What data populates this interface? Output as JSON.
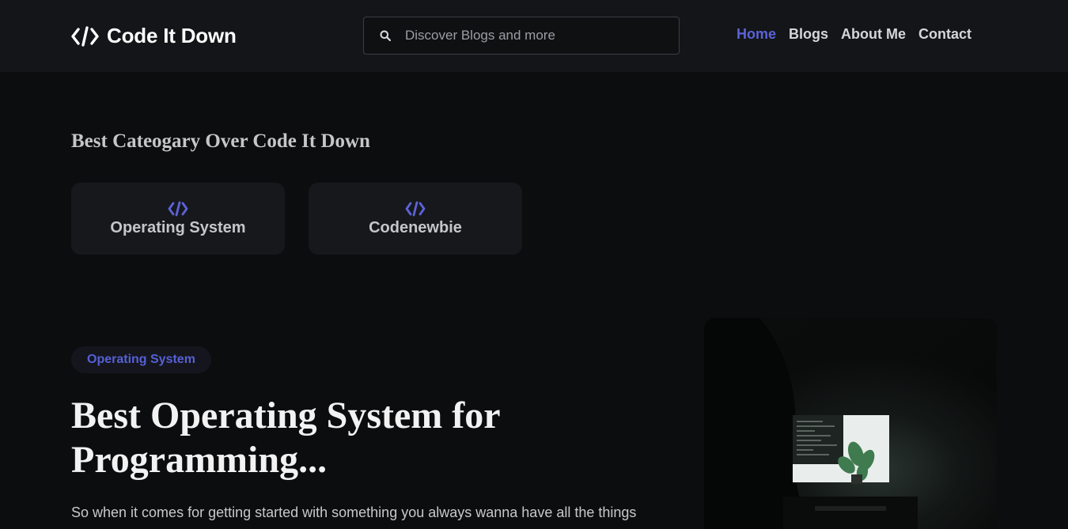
{
  "header": {
    "logo_icon": "code-icon",
    "logo_text": "Code It Down",
    "search": {
      "icon": "search-icon",
      "placeholder": "Discover Blogs and more",
      "value": ""
    },
    "nav": [
      {
        "label": "Home",
        "active": true
      },
      {
        "label": "Blogs",
        "active": false
      },
      {
        "label": "About Me",
        "active": false
      },
      {
        "label": "Contact",
        "active": false
      }
    ]
  },
  "categories": {
    "title": "Best Cateogary Over Code It Down",
    "items": [
      {
        "icon": "code-icon",
        "label": "Operating System"
      },
      {
        "icon": "code-icon",
        "label": "Codenewbie"
      }
    ]
  },
  "featured_post": {
    "tag": "Operating System",
    "title": "Best Operating System for Programming...",
    "excerpt": "So when it comes for getting started with something you always wanna have all the things",
    "image": "dark-desk-monitor-plant-photo"
  },
  "colors": {
    "accent": "#5b63d8",
    "background": "#0c0d0f",
    "navbar": "#131518",
    "card": "#16181b"
  }
}
